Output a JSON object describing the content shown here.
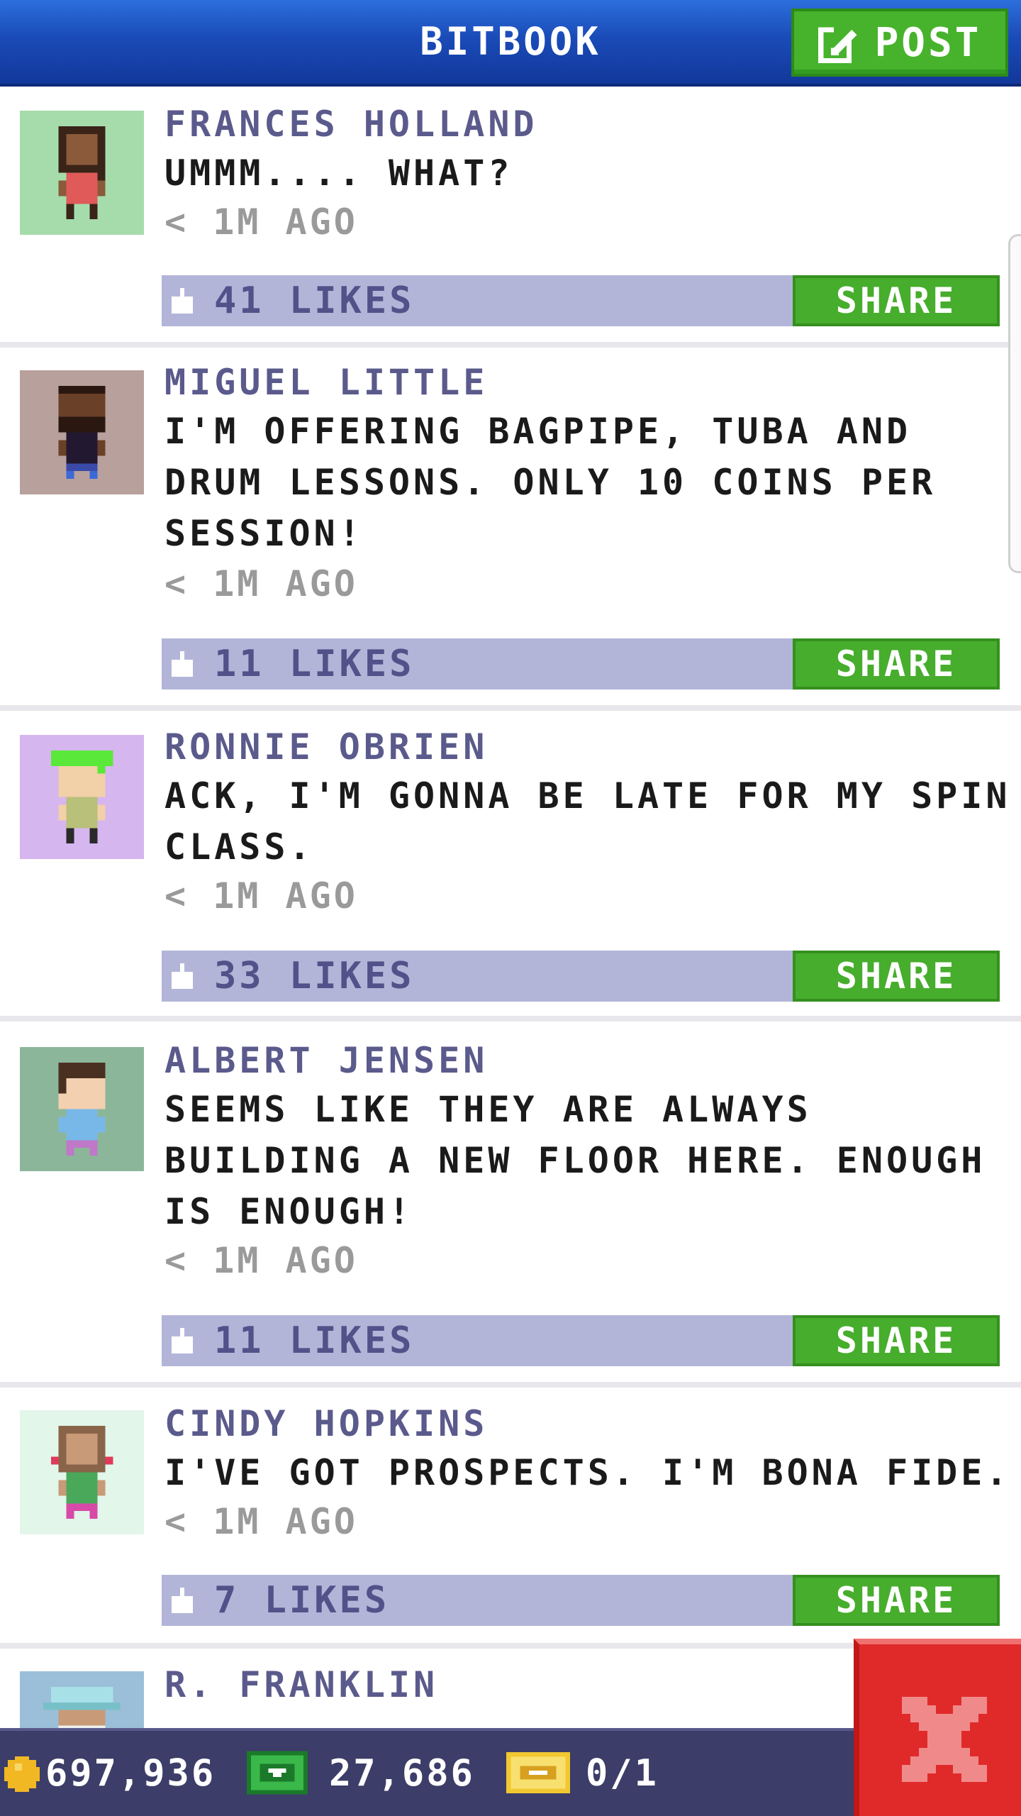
{
  "header": {
    "title": "BITBOOK",
    "post_label": "POST"
  },
  "posts": [
    {
      "author": "FRANCES HOLLAND",
      "message": "UMMM....  WHAT?",
      "time": "< 1M AGO",
      "likes": "41 LIKES",
      "share": "SHARE",
      "avatar_bg": "#a6dcab"
    },
    {
      "author": "MIGUEL LITTLE",
      "message": "I'M OFFERING BAGPIPE, TUBA AND DRUM LESSONS. ONLY 10 COINS PER SESSION!",
      "time": "< 1M AGO",
      "likes": "11 LIKES",
      "share": "SHARE",
      "avatar_bg": "#b8a09c"
    },
    {
      "author": "RONNIE OBRIEN",
      "message": "ACK, I'M GONNA BE LATE FOR MY SPIN CLASS.",
      "time": "< 1M AGO",
      "likes": "33 LIKES",
      "share": "SHARE",
      "avatar_bg": "#d6b6ee"
    },
    {
      "author": "ALBERT JENSEN",
      "message": "SEEMS LIKE THEY ARE ALWAYS BUILDING A NEW FLOOR HERE. ENOUGH IS ENOUGH!",
      "time": "< 1M AGO",
      "likes": "11 LIKES",
      "share": "SHARE",
      "avatar_bg": "#8cb69a"
    },
    {
      "author": "CINDY HOPKINS",
      "message": "I'VE GOT PROSPECTS. I'M BONA FIDE.",
      "time": "< 1M AGO",
      "likes": "7 LIKES",
      "share": "SHARE",
      "avatar_bg": "#e2f6ea"
    },
    {
      "author": "R. FRANKLIN",
      "avatar_bg": "#9bbfd8"
    }
  ],
  "status": {
    "coins": "697,936",
    "bux": "27,686",
    "tickets": "0/1"
  },
  "colors": {
    "header_blue": "#1a4bb8",
    "accent_green": "#47b32c",
    "likes_bar": "#b3b5d8",
    "name_purple": "#5b5a8c",
    "close_red": "#e02a2a"
  }
}
